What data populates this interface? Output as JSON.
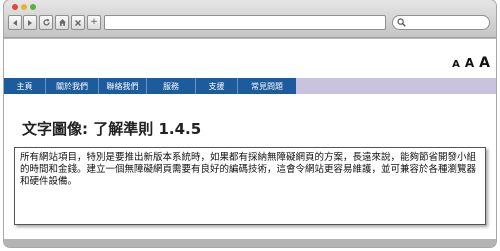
{
  "browser": {
    "toolbar_buttons": [
      {
        "name": "back-icon"
      },
      {
        "name": "forward-icon"
      },
      {
        "name": "reload-icon"
      },
      {
        "name": "home-icon"
      },
      {
        "name": "close-icon"
      },
      {
        "name": "add-icon",
        "label": "+"
      }
    ],
    "address_value": "",
    "search_value": ""
  },
  "header": {
    "font_size_controls": [
      "A",
      "A",
      "A"
    ]
  },
  "nav": {
    "items": [
      {
        "label": "主頁"
      },
      {
        "label": "關於我們"
      },
      {
        "label": "聯絡我們"
      },
      {
        "label": "服務"
      },
      {
        "label": "支援"
      },
      {
        "label": "常見問題"
      }
    ]
  },
  "main": {
    "title": "文字圖像: 了解準則 1.4.5",
    "body_text": "所有網站項目，特別是要推出新版本系統時，如果都有採納無障礙網頁的方案，長遠來說，能夠節省開發小組的時間和金錢。建立一個無障礙網頁需要有良好的編碼技術，這會令網站更容易維護，並可兼容於各種瀏覽器和硬件設備。"
  },
  "colors": {
    "nav_background": "#1c5b9c",
    "nav_extension": "#c9c3dd",
    "text": "#111111"
  }
}
